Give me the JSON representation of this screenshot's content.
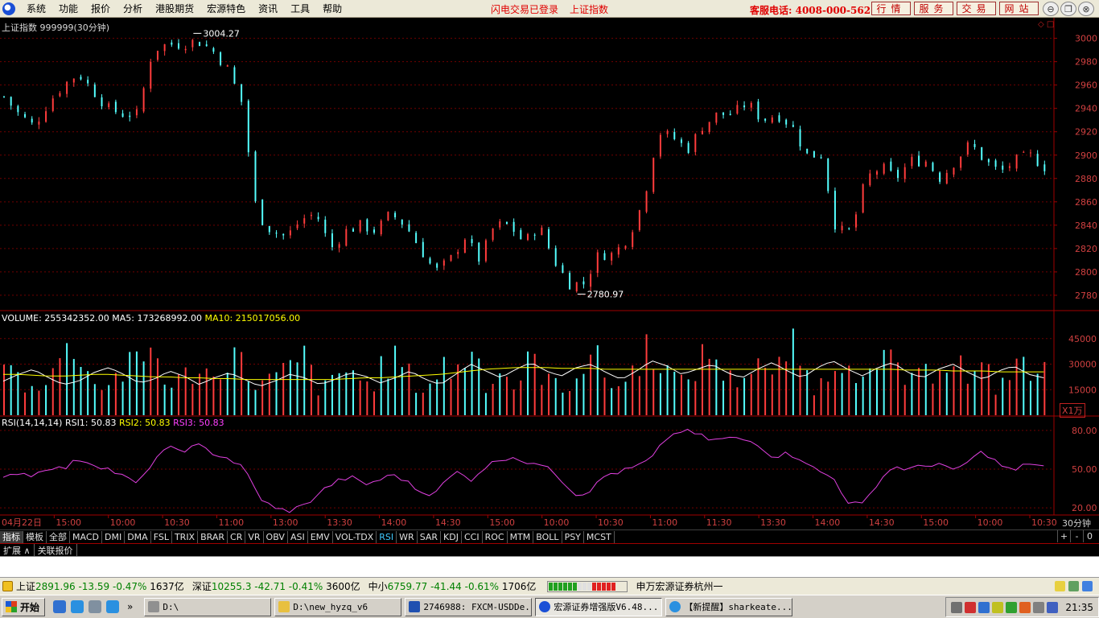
{
  "menu": {
    "items": [
      "系统",
      "功能",
      "报价",
      "分析",
      "港股期货",
      "宏源特色",
      "资讯",
      "工具",
      "帮助"
    ],
    "status": [
      "闪电交易已登录",
      "上证指数"
    ],
    "hotline": "客服电话: 4008-000-562",
    "quick_buttons": [
      "行情",
      "服务",
      "交易",
      "网站"
    ],
    "window_buttons": [
      "⊖",
      "❐",
      "⊗"
    ]
  },
  "chart": {
    "title": "上证指数 999999(30分钟)",
    "unit_label": "X1万",
    "period_label": "30分钟",
    "top_icons": "◇ □",
    "volume_header": {
      "volume": "VOLUME: 255342352.00",
      "ma5": "MA5: 173268992.00",
      "ma10": "MA10: 215017056.00"
    },
    "rsi_header": {
      "name": "RSI(14,14,14)",
      "rsi1": "RSI1: 50.83",
      "rsi2": "RSI2: 50.83",
      "rsi3": "RSI3: 50.83"
    }
  },
  "chart_data": [
    {
      "type": "candlestick",
      "title": "上证指数 999999(30分钟)",
      "y_ticks": [
        3000,
        2980,
        2960,
        2940,
        2920,
        2900,
        2880,
        2860,
        2840,
        2820,
        2800,
        2780
      ],
      "ylim": [
        2771,
        3008
      ],
      "annotations": [
        {
          "label": "3004.27",
          "value": 3004.27
        },
        {
          "label": "2780.97",
          "value": 2780.97
        }
      ],
      "x_tick_labels": [
        "04月22日",
        "15:00",
        "10:00",
        "10:30",
        "11:00",
        "13:00",
        "13:30",
        "14:00",
        "14:30",
        "15:00",
        "10:00",
        "10:30",
        "11:00",
        "11:30",
        "13:30",
        "14:00",
        "14:30",
        "15:00",
        "10:00",
        "10:30"
      ],
      "close_anchors": [
        2950,
        2935,
        2925,
        2945,
        2960,
        2970,
        2955,
        2940,
        2935,
        2935,
        2990,
        2995,
        2995,
        2998,
        2990,
        2975,
        2945,
        2850,
        2835,
        2830,
        2845,
        2850,
        2820,
        2835,
        2840,
        2835,
        2850,
        2840,
        2820,
        2800,
        2810,
        2830,
        2810,
        2840,
        2840,
        2825,
        2840,
        2810,
        2790,
        2790,
        2815,
        2815,
        2830,
        2860,
        2920,
        2915,
        2905,
        2925,
        2935,
        2935,
        2945,
        2930,
        2935,
        2925,
        2900,
        2900,
        2835,
        2835,
        2880,
        2890,
        2880,
        2895,
        2895,
        2880,
        2895,
        2910,
        2895,
        2885,
        2895,
        2900,
        2890
      ],
      "colors": {
        "up": "#ff3c3c",
        "down": "#54ffff"
      }
    },
    {
      "type": "bar",
      "title": "VOLUME",
      "y_ticks": [
        45000,
        30000,
        15000
      ],
      "ylim": [
        0,
        52000
      ],
      "series": [
        {
          "name": "VOLUME",
          "values": [
            32000,
            22000,
            15000,
            29000,
            36000,
            44000,
            18000,
            21000,
            27000,
            33000,
            42000,
            16000,
            24000,
            31000,
            20000,
            45000,
            26000,
            19000,
            23000,
            28000,
            35000,
            14000,
            22000,
            30000,
            17000,
            27000,
            36000,
            22000,
            15000,
            31000,
            26000,
            44000,
            20000,
            28000,
            17000,
            35000,
            24000,
            13000,
            29000,
            38000,
            22000,
            17000,
            33000,
            45000,
            27000,
            18000,
            32000,
            40000,
            21000,
            25000,
            36000,
            19000,
            45000,
            28000,
            16000,
            33000,
            42000,
            20000,
            26000,
            37000,
            18000,
            24000,
            34000,
            40000,
            20000,
            28000,
            15000,
            36000,
            23000,
            31000
          ]
        },
        {
          "name": "MA5",
          "values": [
            20000,
            24000,
            27000,
            22000,
            18000,
            20000,
            25000,
            28000,
            24000,
            19000,
            21000,
            26000,
            23000,
            18000,
            22000,
            25000,
            21000,
            17000,
            20000,
            24000,
            22000,
            18000,
            21000,
            25000,
            23000,
            19000,
            22000,
            26000,
            21000,
            18000,
            24000,
            30000,
            26000,
            22000,
            27000,
            31000,
            26000,
            23000,
            28000,
            30000,
            25000,
            21000,
            26000,
            32000,
            29000,
            24000,
            27000,
            30000,
            25000,
            22000,
            27000,
            31000,
            26000,
            22000,
            28000,
            32000,
            27000,
            23000,
            28000,
            31000,
            25000,
            22000,
            27000,
            30000,
            25000,
            21000,
            26000,
            29000,
            24000,
            22000
          ]
        },
        {
          "name": "MA10",
          "values": [
            24000,
            24000,
            23500,
            23000,
            23000,
            23500,
            24000,
            24000,
            23500,
            23000,
            22500,
            22500,
            22000,
            22000,
            21500,
            21500,
            21000,
            21000,
            21000,
            21000,
            21000,
            21000,
            21000,
            21500,
            22000,
            22000,
            22500,
            23000,
            23500,
            24000,
            25000,
            26000,
            27000,
            27500,
            28000,
            28000,
            28000,
            27500,
            27500,
            27500,
            27000,
            27000,
            27000,
            27000,
            27000,
            27000,
            27000,
            27000,
            27000,
            27000,
            27000,
            27000,
            27000,
            27000,
            27000,
            27000,
            27000,
            27000,
            27000,
            27000,
            26500,
            26500,
            26500,
            26000,
            26000,
            26000,
            25500,
            25500,
            25500,
            25500
          ]
        }
      ],
      "colors": {
        "volume_header": "#ffffff",
        "ma5": "#ffffff",
        "ma10": "#ffff00"
      }
    },
    {
      "type": "line",
      "title": "RSI(14,14,14)",
      "y_ticks": [
        80.0,
        50.0,
        20.0
      ],
      "ylim": [
        17,
        83
      ],
      "series": [
        {
          "name": "RSI1",
          "values": [
            42,
            48,
            45,
            52,
            50,
            58,
            54,
            50,
            44,
            38,
            58,
            66,
            65,
            68,
            62,
            58,
            50,
            28,
            19,
            18,
            22,
            32,
            40,
            44,
            38,
            42,
            46,
            38,
            30,
            36,
            48,
            42,
            52,
            58,
            60,
            52,
            55,
            42,
            30,
            34,
            46,
            48,
            52,
            58,
            74,
            80,
            77,
            72,
            74,
            73,
            70,
            60,
            62,
            58,
            48,
            44,
            25,
            22,
            40,
            52,
            50,
            52,
            55,
            48,
            56,
            64,
            54,
            48,
            55,
            52
          ]
        }
      ],
      "colors": {
        "rsi1": "#ffffff",
        "rsi2": "#ffff00",
        "rsi3": "#ff00ff",
        "line": "#e040e0"
      }
    }
  ],
  "indicator_tabs": [
    "指标",
    "模板",
    "全部",
    "MACD",
    "DMI",
    "DMA",
    "FSL",
    "TRIX",
    "BRAR",
    "CR",
    "VR",
    "OBV",
    "ASI",
    "EMV",
    "VOL-TDX",
    "RSI",
    "WR",
    "SAR",
    "KDJ",
    "CCI",
    "ROC",
    "MTM",
    "BOLL",
    "PSY",
    "MCST"
  ],
  "active_indicator": "RSI",
  "zoom_controls": [
    "+",
    "-",
    "0"
  ],
  "extension_tabs": [
    "扩展",
    "关联报价"
  ],
  "ticker": {
    "sh": {
      "name": "上证",
      "value": "2891.96",
      "change": "-13.59",
      "pct": "-0.47%",
      "amount": "1637亿"
    },
    "sz": {
      "name": "深证",
      "value": "10255.3",
      "change": "-42.71",
      "pct": "-0.41%",
      "amount": "3600亿"
    },
    "zx": {
      "name": "中小",
      "value": "6759.77",
      "change": "-41.44",
      "pct": "-0.61%",
      "amount": "1706亿"
    },
    "broker": "申万宏源证券杭州一"
  },
  "taskbar": {
    "start_label": "开始",
    "quick_more": "»",
    "tasks": [
      "D:\\",
      "D:\\new_hyzq_v6",
      "2746988: FXCM-USDDe...",
      "宏源证券增强版V6.48...",
      "【新提醒】sharkeate..."
    ],
    "clock": "21:35"
  }
}
